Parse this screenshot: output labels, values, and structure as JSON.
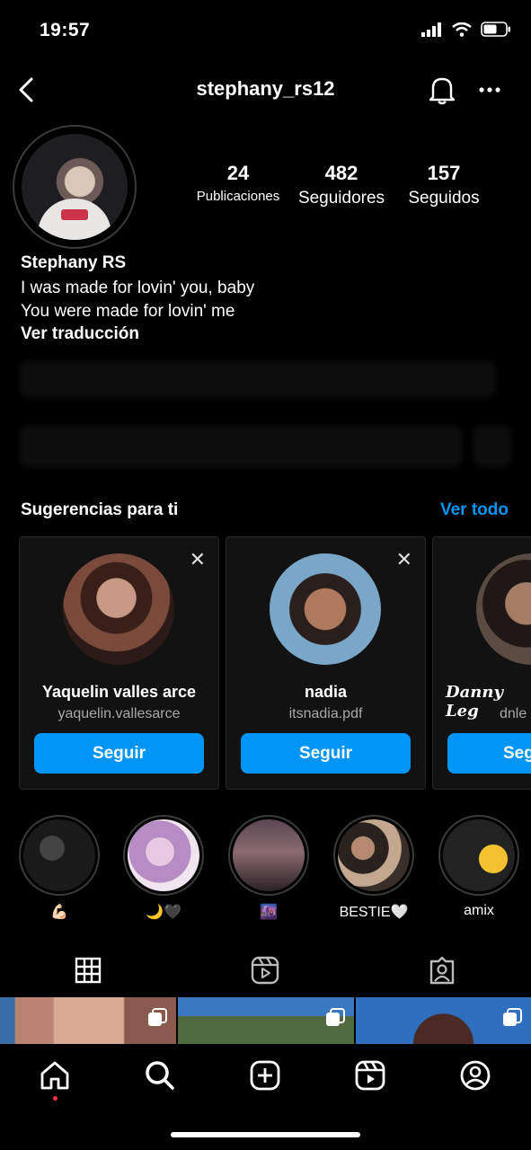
{
  "status_bar": {
    "time": "19:57"
  },
  "header": {
    "username": "stephany_rs12"
  },
  "profile": {
    "stats": [
      {
        "value": "24",
        "label": "Publicaciones"
      },
      {
        "value": "482",
        "label": "Seguidores"
      },
      {
        "value": "157",
        "label": "Seguidos"
      }
    ],
    "display_name": "Stephany RS",
    "bio_line1": "I was made for lovin' you, baby",
    "bio_line2": "You were made for lovin' me",
    "translate": "Ver traducción"
  },
  "suggestions": {
    "title": "Sugerencias para ti",
    "see_all": "Ver todo",
    "close_glyph": "✕",
    "cards": [
      {
        "name": "Yaquelin valles arce",
        "username": "yaquelin.vallesarce",
        "button": "Seguir"
      },
      {
        "name": "nadia",
        "username": "itsnadia.pdf",
        "button": "Seguir"
      },
      {
        "name": "Danny Leg",
        "username": "dnle",
        "button": "Seg"
      }
    ]
  },
  "highlights": [
    {
      "caption": "💪🏻"
    },
    {
      "caption": "🌙🖤"
    },
    {
      "caption": "🌆"
    },
    {
      "caption": "BESTIE🤍"
    },
    {
      "caption": "amix"
    }
  ],
  "tabs": [
    "grid-icon",
    "reels-icon",
    "tagged-icon"
  ],
  "bottom_nav": [
    "home-icon",
    "search-icon",
    "create-icon",
    "reels-icon",
    "profile-icon"
  ],
  "colors": {
    "accent": "#0095f6",
    "background": "#000000",
    "card": "#121212"
  }
}
